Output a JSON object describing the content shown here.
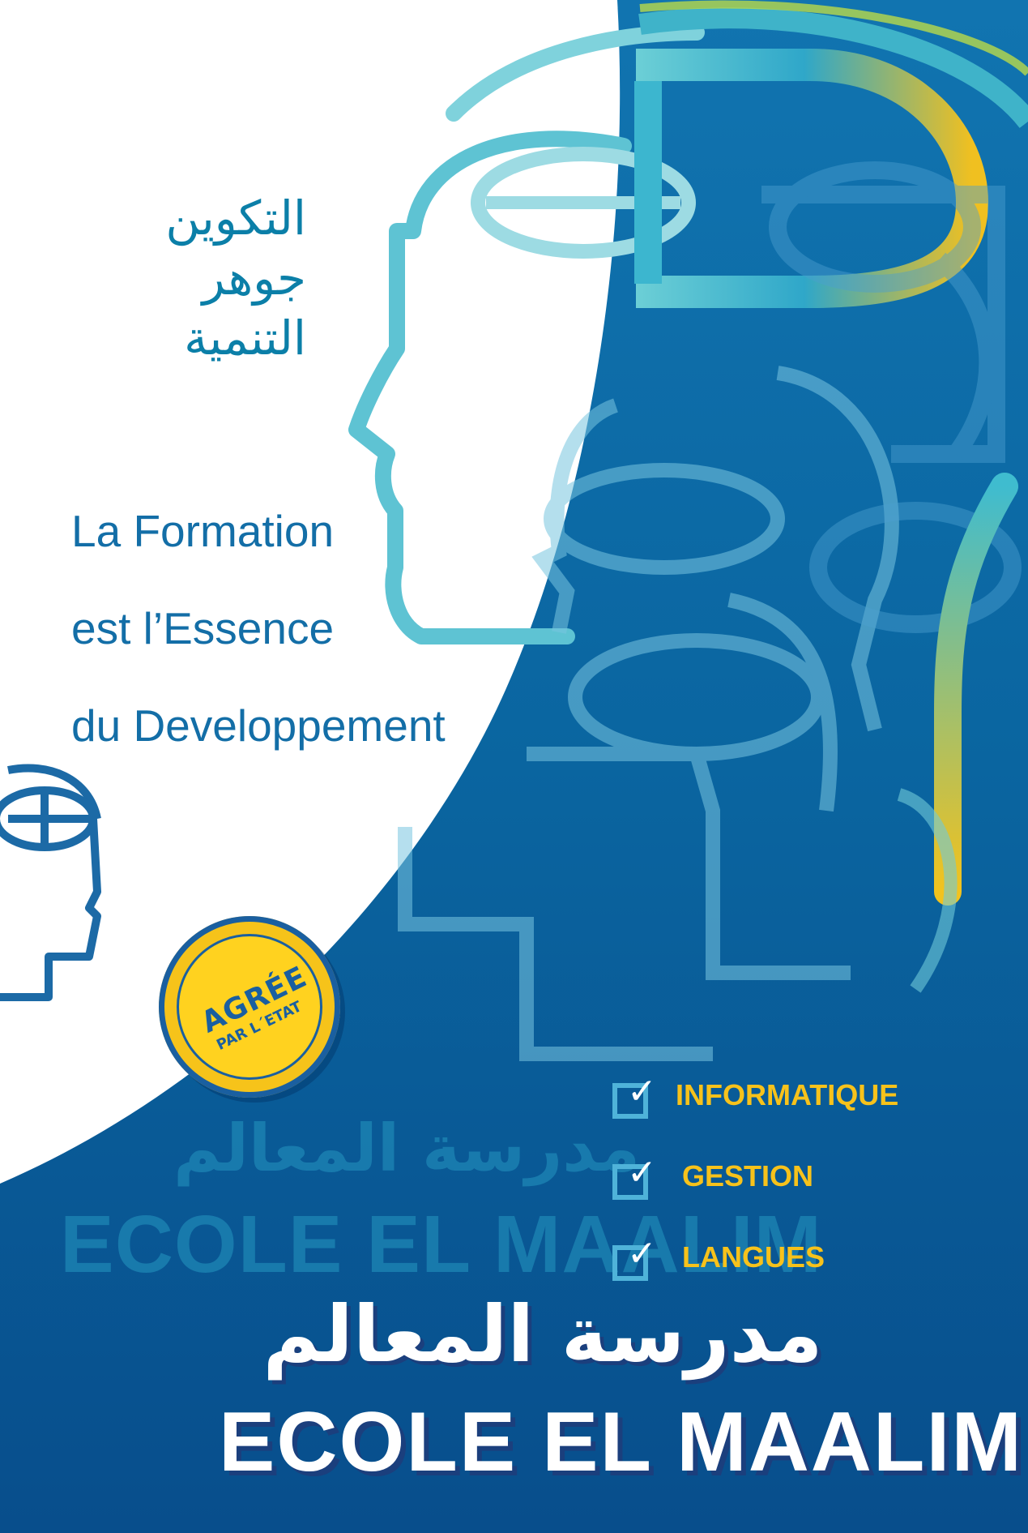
{
  "arabic_slogan": {
    "line1": "التكوين",
    "line2": "جوهر",
    "line3": "التنمية"
  },
  "french_slogan": {
    "line1": "La Formation",
    "line2": "est l’Essence",
    "line3": "du Developpement"
  },
  "badge": {
    "main": "AGRÉE",
    "sub": "PAR L´ETAT"
  },
  "ghost_watermark": {
    "arabic": "مدرسة المعالم",
    "french": "ECOLE EL MAALIM"
  },
  "services": [
    "INFORMATIQUE",
    "GESTION",
    "LANGUES"
  ],
  "school_name": {
    "arabic": "مدرسة المعالم",
    "french": "ECOLE EL MAALIM"
  },
  "colors": {
    "deep_blue": "#0a5a96",
    "cyan": "#3fb3c9",
    "yellow": "#f7c21b",
    "text_blue": "#136ea7"
  },
  "icons": [
    "head-profile-icon",
    "logo-head-icon",
    "checkbox-icon"
  ]
}
